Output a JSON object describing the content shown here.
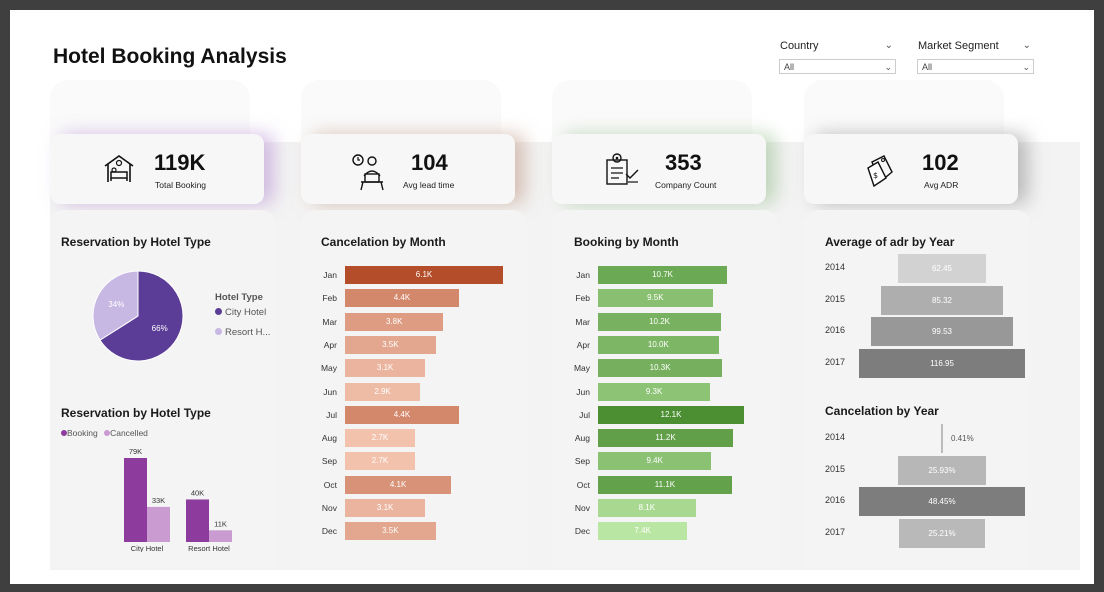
{
  "title": "Hotel Booking Analysis",
  "filters": [
    {
      "label": "Country",
      "value": "All"
    },
    {
      "label": "Market Segment",
      "value": "All"
    }
  ],
  "kpis": [
    {
      "value": "119K",
      "label": "Total Booking",
      "icon": "hotel-bed-icon",
      "accent": "#c9a9de"
    },
    {
      "value": "104",
      "label": "Avg lead time",
      "icon": "person-clock-icon",
      "accent": "#c8a898"
    },
    {
      "value": "353",
      "label": "Company Count",
      "icon": "company-document-icon",
      "accent": "#b5cfa9"
    },
    {
      "value": "102",
      "label": "Avg ADR",
      "icon": "price-tag-icon",
      "accent": "#a9a9a9"
    }
  ],
  "pie": {
    "title": "Reservation by Hotel Type",
    "legend_title": "Hotel Type",
    "slices": [
      {
        "name": "City Hotel",
        "label": "66%",
        "value": 66,
        "color": "#5b3c96"
      },
      {
        "name": "Resort H...",
        "label": "34%",
        "value": 34,
        "color": "#c7b7e3"
      }
    ]
  },
  "hotel_bars": {
    "title": "Reservation by Hotel Type",
    "legend": [
      {
        "name": "Booking",
        "color": "#8e3b9e"
      },
      {
        "name": "Cancelled",
        "color": "#c99bd0"
      }
    ],
    "categories": [
      "City Hotel",
      "Resort Hotel"
    ],
    "booking": [
      79,
      40
    ],
    "booking_labels": [
      "79K",
      "40K"
    ],
    "cancelled": [
      33,
      11
    ],
    "cancelled_labels": [
      "33K",
      "11K"
    ]
  },
  "cancel_month": {
    "title": "Cancelation by Month",
    "months": [
      "Jan",
      "Feb",
      "Mar",
      "Apr",
      "May",
      "Jun",
      "Jul",
      "Aug",
      "Sep",
      "Oct",
      "Nov",
      "Dec"
    ],
    "values": [
      6.1,
      4.4,
      3.8,
      3.5,
      3.1,
      2.9,
      4.4,
      2.7,
      2.7,
      4.1,
      3.1,
      3.5
    ],
    "labels": [
      "6.1K",
      "4.4K",
      "3.8K",
      "3.5K",
      "3.1K",
      "2.9K",
      "4.4K",
      "2.7K",
      "2.7K",
      "4.1K",
      "3.1K",
      "3.5K"
    ]
  },
  "booking_month": {
    "title": "Booking by Month",
    "months": [
      "Jan",
      "Feb",
      "Mar",
      "Apr",
      "May",
      "Jun",
      "Jul",
      "Aug",
      "Sep",
      "Oct",
      "Nov",
      "Dec"
    ],
    "values": [
      10.7,
      9.5,
      10.2,
      10.0,
      10.3,
      9.3,
      12.1,
      11.2,
      9.4,
      11.1,
      8.1,
      7.4
    ],
    "labels": [
      "10.7K",
      "9.5K",
      "10.2K",
      "10.0K",
      "10.3K",
      "9.3K",
      "12.1K",
      "11.2K",
      "9.4K",
      "11.1K",
      "8.1K",
      "7.4K"
    ]
  },
  "adr_year": {
    "title": "Average of adr by Year",
    "years": [
      "2014",
      "2015",
      "2016",
      "2017"
    ],
    "values": [
      62.45,
      85.32,
      99.53,
      116.95
    ],
    "labels": [
      "62.45",
      "85.32",
      "99.53",
      "116.95"
    ]
  },
  "cancel_year": {
    "title": "Cancelation by Year",
    "years": [
      "2014",
      "2015",
      "2016",
      "2017"
    ],
    "values": [
      0.41,
      25.93,
      48.45,
      25.21
    ],
    "labels": [
      "0.41%",
      "25.93%",
      "48.45%",
      "25.21%"
    ]
  }
}
